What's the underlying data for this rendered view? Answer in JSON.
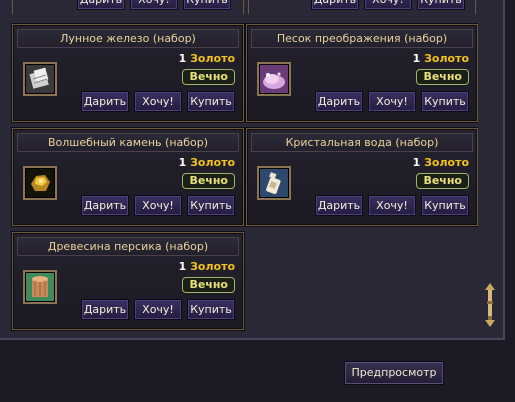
{
  "buttons": {
    "gift": "Дарить",
    "want": "Хочу!",
    "buy": "Купить"
  },
  "currency": "Золото",
  "items": [
    {
      "title": "Лунное железо (набор)",
      "price": "1",
      "duration": "Вечно",
      "icon": "moon-iron-icon"
    },
    {
      "title": "Песок преображения (набор)",
      "price": "1",
      "duration": "Вечно",
      "icon": "transformation-sand-icon"
    },
    {
      "title": "Волшебный камень (набор)",
      "price": "1",
      "duration": "Вечно",
      "icon": "magic-stone-icon"
    },
    {
      "title": "Кристальная вода (набор)",
      "price": "1",
      "duration": "Вечно",
      "icon": "crystal-water-icon"
    },
    {
      "title": "Древесина персика (набор)",
      "price": "1",
      "duration": "Вечно",
      "icon": "peach-wood-icon"
    }
  ],
  "preview_label": "Предпросмотр",
  "colors": {
    "gold": "#f2c21a",
    "badge_text": "#e6e07a",
    "title_text": "#e8d39a",
    "button_bg": "#2f2650"
  }
}
